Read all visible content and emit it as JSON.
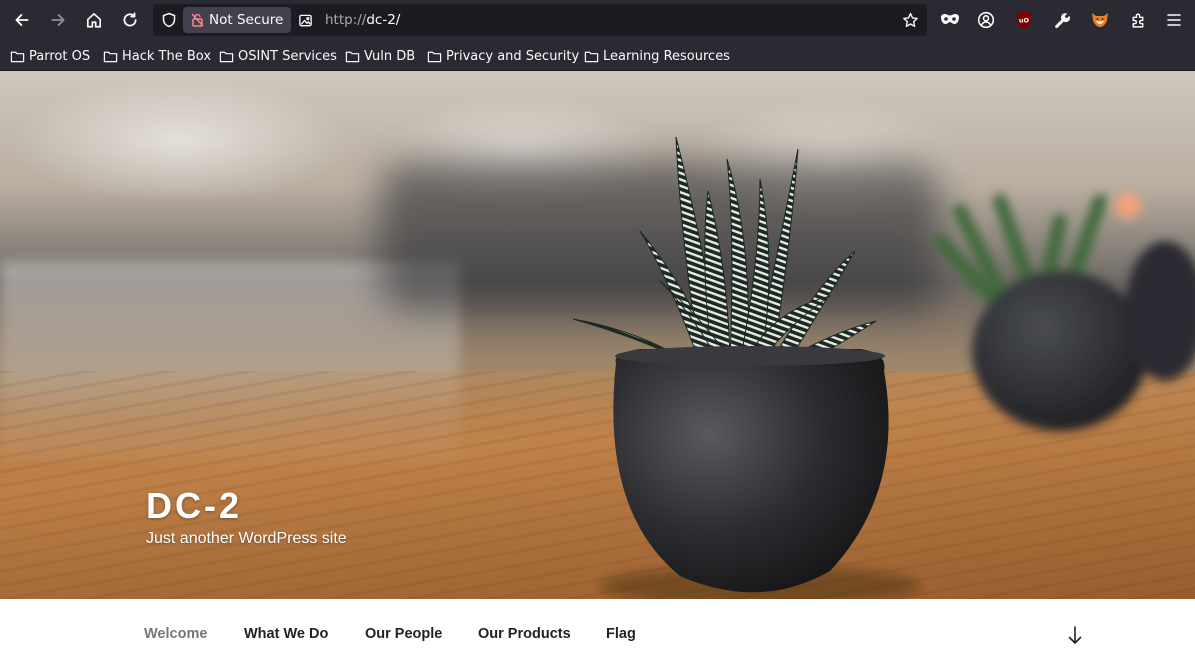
{
  "browser": {
    "security_label": "Not Secure",
    "url_protocol": "http://",
    "url_host": "dc-2/",
    "bookmarks": [
      {
        "label": "Parrot OS"
      },
      {
        "label": "Hack The Box"
      },
      {
        "label": "OSINT Services"
      },
      {
        "label": "Vuln DB"
      },
      {
        "label": "Privacy and Security"
      },
      {
        "label": "Learning Resources"
      }
    ],
    "ublock_badge": "uO"
  },
  "site": {
    "title": "DC-2",
    "tagline": "Just another WordPress site"
  },
  "nav": {
    "items": [
      {
        "label": "Welcome"
      },
      {
        "label": "What We Do"
      },
      {
        "label": "Our People"
      },
      {
        "label": "Our Products"
      },
      {
        "label": "Flag"
      }
    ]
  },
  "colors": {
    "toolbar_bg": "#2b2a33",
    "urlbar_bg": "#1c1b22",
    "not_secure_lock": "#ff848b",
    "nav_current": "#767676"
  }
}
